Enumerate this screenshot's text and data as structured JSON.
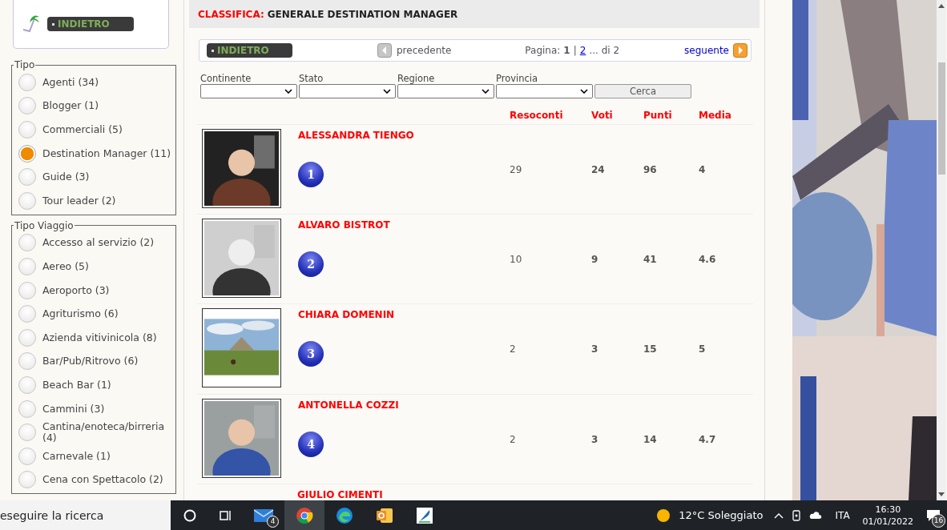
{
  "sidebar": {
    "back_button": "INDIETRO",
    "groups": [
      {
        "legend": "Tipo",
        "options": [
          {
            "label": "Agenti (34)",
            "selected": false
          },
          {
            "label": "Blogger (1)",
            "selected": false
          },
          {
            "label": "Commerciali (5)",
            "selected": false
          },
          {
            "label": "Destination Manager (11)",
            "selected": true
          },
          {
            "label": "Guide (3)",
            "selected": false
          },
          {
            "label": "Tour leader (2)",
            "selected": false
          }
        ]
      },
      {
        "legend": "Tipo Viaggio",
        "options": [
          {
            "label": "Accesso al servizio (2)",
            "selected": false
          },
          {
            "label": "Aereo (5)",
            "selected": false
          },
          {
            "label": "Aeroporto (3)",
            "selected": false
          },
          {
            "label": "Agriturismo (6)",
            "selected": false
          },
          {
            "label": "Azienda vitivinicola (8)",
            "selected": false
          },
          {
            "label": "Bar/Pub/Ritrovo (6)",
            "selected": false
          },
          {
            "label": "Beach Bar (1)",
            "selected": false
          },
          {
            "label": "Cammini (3)",
            "selected": false
          },
          {
            "label": "Cantina/enoteca/birreria (4)",
            "selected": false
          },
          {
            "label": "Carnevale (1)",
            "selected": false
          },
          {
            "label": "Cena con Spettacolo (2)",
            "selected": false
          }
        ]
      }
    ]
  },
  "header": {
    "label": "CLASSIFICA:",
    "title": "GENERALE DESTINATION MANAGER"
  },
  "pager": {
    "back_button": "INDIETRO",
    "previous": "precedente",
    "page_label": "Pagina:",
    "current": "1",
    "separator": "|",
    "next_page": "2",
    "rest": "... di 2",
    "next": "seguente"
  },
  "filters": [
    {
      "label": "Continente"
    },
    {
      "label": "Stato"
    },
    {
      "label": "Regione"
    },
    {
      "label": "Provincia"
    }
  ],
  "search_button": "Cerca",
  "columns": [
    "Resoconti",
    "Voti",
    "Punti",
    "Media"
  ],
  "rows": [
    {
      "name": "ALESSANDRA TIENGO",
      "rank": "1",
      "resoconti": "29",
      "voti": "24",
      "punti": "96",
      "media": "4"
    },
    {
      "name": "ALVARO BISTROT",
      "rank": "2",
      "resoconti": "10",
      "voti": "9",
      "punti": "41",
      "media": "4.6"
    },
    {
      "name": "CHIARA DOMENIN",
      "rank": "3",
      "resoconti": "2",
      "voti": "3",
      "punti": "15",
      "media": "5"
    },
    {
      "name": "ANTONELLA COZZI",
      "rank": "4",
      "resoconti": "2",
      "voti": "3",
      "punti": "14",
      "media": "4.7"
    },
    {
      "name": "GIULIO CIMENTI"
    }
  ],
  "taskbar": {
    "search": "eseguire la ricerca",
    "mail_badge": "4",
    "weather": "12°C Soleggiato",
    "language": "ITA",
    "time": "16:30",
    "date": "01/01/2022",
    "notifications": "16"
  }
}
